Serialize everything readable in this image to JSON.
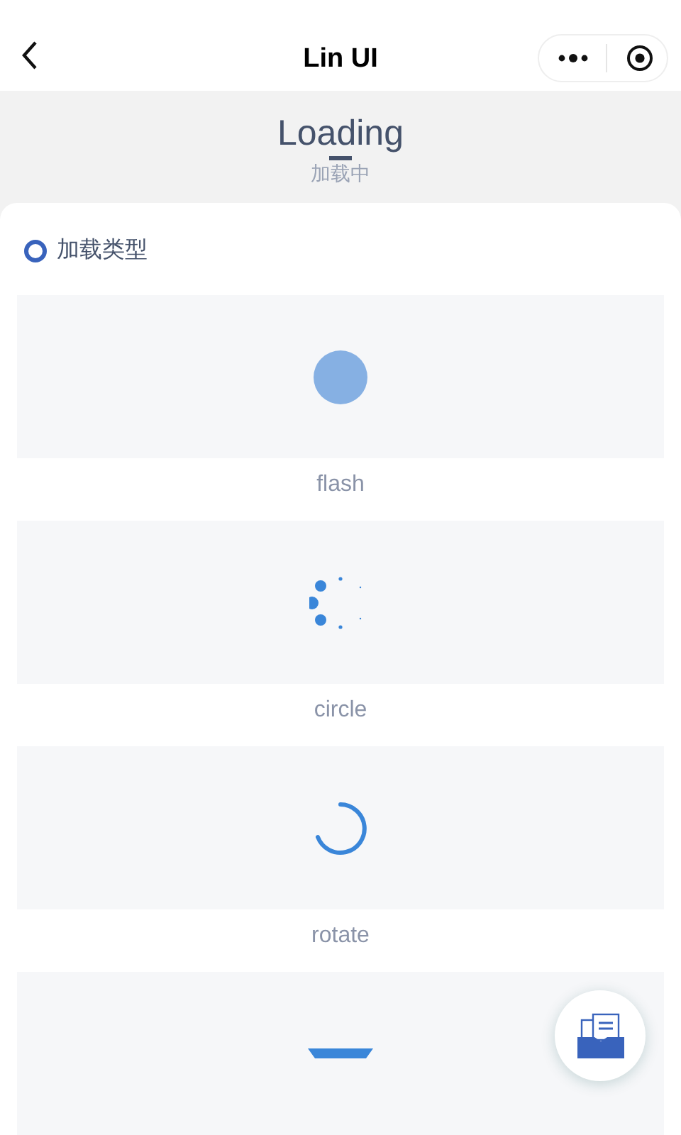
{
  "nav": {
    "title": "Lin UI"
  },
  "header": {
    "title": "Loading",
    "subtitle": "加载中"
  },
  "section": {
    "title": "加载类型"
  },
  "loaders": [
    {
      "kind": "flash",
      "label": "flash"
    },
    {
      "kind": "circle",
      "label": "circle"
    },
    {
      "kind": "rotate",
      "label": "rotate"
    },
    {
      "kind": "bar"
    }
  ]
}
